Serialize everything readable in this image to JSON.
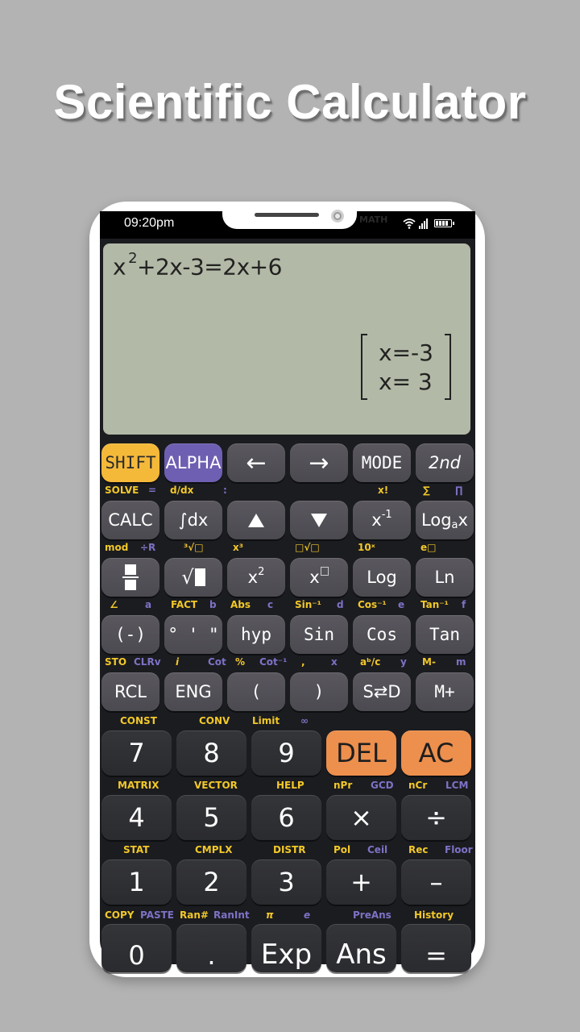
{
  "promo": {
    "title": "Scientific Calculator"
  },
  "status_bar": {
    "time": "09:20pm",
    "faint_text": "MATH",
    "icons": [
      "wifi-icon",
      "signal-icon",
      "battery-icon"
    ]
  },
  "display": {
    "expression_base": "x",
    "expression_exponent": "2",
    "expression_rest": "+2x-3=2x+6",
    "results": [
      "x=-3",
      "x= 3"
    ]
  },
  "rows": [
    {
      "keys": [
        {
          "label": "SHIFT",
          "style": "shift"
        },
        {
          "label": "ALPHA",
          "style": "alpha"
        },
        {
          "label": "←",
          "icon": "arrow-left-icon"
        },
        {
          "label": "→",
          "icon": "arrow-right-icon"
        },
        {
          "label": "MODE"
        },
        {
          "label": "2nd"
        }
      ],
      "sublabels": [
        {
          "text": "SOLVE",
          "color": "yellow"
        },
        {
          "text": "=",
          "color": "purple"
        },
        {
          "text": "d/dx",
          "color": "yellow"
        },
        {
          "text": ":",
          "color": "purple"
        },
        {
          "text": "x!",
          "color": "yellow"
        },
        {
          "text": "∑",
          "color": "yellow"
        },
        {
          "text": "∏",
          "color": "purple"
        }
      ]
    },
    {
      "keys": [
        {
          "label": "CALC"
        },
        {
          "label": "∫dx"
        },
        {
          "label": "",
          "icon": "up-triangle-icon"
        },
        {
          "label": "",
          "icon": "down-triangle-icon"
        },
        {
          "label": "x",
          "sup": "-1"
        },
        {
          "label": "Log",
          "sub": "a",
          "suffix": "x"
        }
      ],
      "sublabels": [
        {
          "text": "mod",
          "color": "yellow"
        },
        {
          "text": "÷R",
          "color": "purple"
        },
        {
          "text": "³√□",
          "color": "yellow"
        },
        {
          "text": "x³",
          "color": "yellow"
        },
        {
          "text": "□√□",
          "color": "yellow"
        },
        {
          "text": "10ˣ",
          "color": "yellow"
        },
        {
          "text": "e□",
          "color": "yellow"
        }
      ]
    },
    {
      "keys": [
        {
          "label": "",
          "icon": "fraction-icon"
        },
        {
          "label": "",
          "icon": "square-root-icon"
        },
        {
          "label": "x",
          "sup": "2"
        },
        {
          "label": "x",
          "icon": "power-box-icon"
        },
        {
          "label": "Log"
        },
        {
          "label": "Ln"
        }
      ],
      "sublabels": [
        {
          "text": "∠",
          "color": "yellow"
        },
        {
          "text": "a",
          "color": "purple"
        },
        {
          "text": "FACT",
          "color": "yellow"
        },
        {
          "text": "b",
          "color": "purple"
        },
        {
          "text": "Abs",
          "color": "yellow"
        },
        {
          "text": "c",
          "color": "purple"
        },
        {
          "text": "Sin⁻¹",
          "color": "yellow"
        },
        {
          "text": "d",
          "color": "purple"
        },
        {
          "text": "Cos⁻¹",
          "color": "yellow"
        },
        {
          "text": "e",
          "color": "purple"
        },
        {
          "text": "Tan⁻¹",
          "color": "yellow"
        },
        {
          "text": "f",
          "color": "purple"
        }
      ]
    },
    {
      "keys": [
        {
          "label": "(-)"
        },
        {
          "label": "° ' \""
        },
        {
          "label": "hyp"
        },
        {
          "label": "Sin"
        },
        {
          "label": "Cos"
        },
        {
          "label": "Tan"
        }
      ],
      "sublabels": [
        {
          "text": "STO",
          "color": "yellow"
        },
        {
          "text": "CLRv",
          "color": "purple"
        },
        {
          "text": "i",
          "color": "yellow"
        },
        {
          "text": "Cot",
          "color": "purple"
        },
        {
          "text": "%",
          "color": "yellow"
        },
        {
          "text": "Cot⁻¹",
          "color": "purple"
        },
        {
          "text": ",",
          "color": "yellow"
        },
        {
          "text": "x",
          "color": "purple"
        },
        {
          "text": "aᵇ/c",
          "color": "yellow"
        },
        {
          "text": "y",
          "color": "purple"
        },
        {
          "text": "M-",
          "color": "yellow"
        },
        {
          "text": "m",
          "color": "purple"
        }
      ]
    },
    {
      "keys": [
        {
          "label": "RCL"
        },
        {
          "label": "ENG"
        },
        {
          "label": "("
        },
        {
          "label": ")"
        },
        {
          "label": "S⇄D"
        },
        {
          "label": "M+"
        }
      ],
      "sublabels": [
        {
          "text": "CONST",
          "color": "yellow"
        },
        {
          "text": "CONV",
          "color": "yellow"
        },
        {
          "text": "Limit",
          "color": "yellow"
        },
        {
          "text": "∞",
          "color": "purple"
        }
      ]
    },
    {
      "keys": [
        {
          "label": "7"
        },
        {
          "label": "8"
        },
        {
          "label": "9"
        },
        {
          "label": "DEL",
          "style": "orange"
        },
        {
          "label": "AC",
          "style": "orange"
        }
      ],
      "sublabels": [
        {
          "text": "MATRIX",
          "color": "yellow"
        },
        {
          "text": "VECTOR",
          "color": "yellow"
        },
        {
          "text": "HELP",
          "color": "yellow"
        },
        {
          "text": "nPr",
          "color": "yellow"
        },
        {
          "text": "GCD",
          "color": "purple"
        },
        {
          "text": "nCr",
          "color": "yellow"
        },
        {
          "text": "LCM",
          "color": "purple"
        }
      ]
    },
    {
      "keys": [
        {
          "label": "4"
        },
        {
          "label": "5"
        },
        {
          "label": "6"
        },
        {
          "label": "×"
        },
        {
          "label": "÷"
        }
      ],
      "sublabels": [
        {
          "text": "STAT",
          "color": "yellow"
        },
        {
          "text": "CMPLX",
          "color": "yellow"
        },
        {
          "text": "DISTR",
          "color": "yellow"
        },
        {
          "text": "Pol",
          "color": "yellow"
        },
        {
          "text": "Ceil",
          "color": "purple"
        },
        {
          "text": "Rec",
          "color": "yellow"
        },
        {
          "text": "Floor",
          "color": "purple"
        }
      ]
    },
    {
      "keys": [
        {
          "label": "1"
        },
        {
          "label": "2"
        },
        {
          "label": "3"
        },
        {
          "label": "+"
        },
        {
          "label": "–"
        }
      ],
      "sublabels": [
        {
          "text": "COPY",
          "color": "yellow"
        },
        {
          "text": "PASTE",
          "color": "purple"
        },
        {
          "text": "Ran#",
          "color": "yellow"
        },
        {
          "text": "RanInt",
          "color": "purple"
        },
        {
          "text": "π",
          "color": "yellow"
        },
        {
          "text": "e",
          "color": "purple"
        },
        {
          "text": "PreAns",
          "color": "purple"
        },
        {
          "text": "History",
          "color": "yellow"
        }
      ]
    },
    {
      "keys": [
        {
          "label": "0"
        },
        {
          "label": "."
        },
        {
          "label": "Exp"
        },
        {
          "label": "Ans"
        },
        {
          "label": "="
        }
      ]
    }
  ],
  "colors": {
    "shift": "#f5b93a",
    "alpha": "#6e5fb2",
    "orange": "#ed8f4d",
    "lcd": "#b2b9a6",
    "yellow_label": "#f2c829",
    "purple_label": "#7d72c6"
  }
}
